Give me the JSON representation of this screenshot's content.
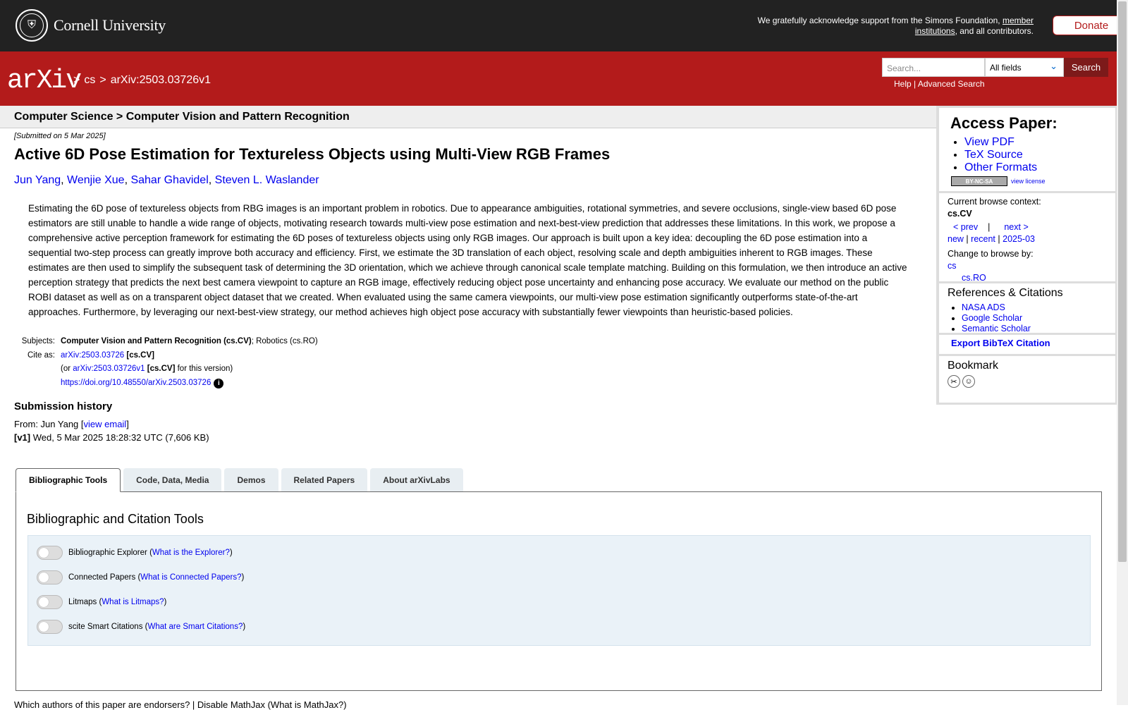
{
  "header": {
    "institution": "Cornell University",
    "support_pre": "We gratefully acknowledge support from the Simons Foundation,",
    "support_link": "member institutions",
    "support_post": ", and all contributors.",
    "donate": "Donate"
  },
  "nav": {
    "logo": "arXiv",
    "crumb_sep1": ">",
    "crumb_cs": "cs",
    "crumb_sep2": ">",
    "crumb_id": "arXiv:2503.03726v1",
    "search_placeholder": "Search...",
    "search_field": "All fields",
    "search_button": "Search",
    "help": "Help",
    "sep": "|",
    "advanced": "Advanced Search"
  },
  "paper": {
    "subject_header": "Computer Science > Computer Vision and Pattern Recognition",
    "submitted": "[Submitted on 5 Mar 2025]",
    "title": "Active 6D Pose Estimation for Textureless Objects using Multi-View RGB Frames",
    "authors": [
      "Jun Yang",
      "Wenjie Xue",
      "Sahar Ghavidel",
      "Steven L. Waslander"
    ],
    "abstract": "Estimating the 6D pose of textureless objects from RBG images is an important problem in robotics. Due to appearance ambiguities, rotational symmetries, and severe occlusions, single-view based 6D pose estimators are still unable to handle a wide range of objects, motivating research towards multi-view pose estimation and next-best-view prediction that addresses these limitations. In this work, we propose a comprehensive active perception framework for estimating the 6D poses of textureless objects using only RGB images. Our approach is built upon a key idea: decoupling the 6D pose estimation into a sequential two-step process can greatly improve both accuracy and efficiency. First, we estimate the 3D translation of each object, resolving scale and depth ambiguities inherent to RGB images. These estimates are then used to simplify the subsequent task of determining the 3D orientation, which we achieve through canonical scale template matching. Building on this formulation, we then introduce an active perception strategy that predicts the next best camera viewpoint to capture an RGB image, effectively reducing object pose uncertainty and enhancing pose accuracy. We evaluate our method on the public ROBI dataset as well as on a transparent object dataset that we created. When evaluated using the same camera viewpoints, our multi-view pose estimation significantly outperforms state-of-the-art approaches. Furthermore, by leveraging our next-best-view strategy, our method achieves high object pose accuracy with substantially fewer viewpoints than heuristic-based policies.",
    "subjects_label": "Subjects:",
    "subjects_primary": "Computer Vision and Pattern Recognition (cs.CV)",
    "subjects_rest": "; Robotics (cs.RO)",
    "cite_label": "Cite as:",
    "cite_id": "arXiv:2503.03726",
    "cite_cat": "[cs.CV]",
    "cite_or": "(or",
    "cite_version_id": "arXiv:2503.03726v1",
    "cite_version_cat": "[cs.CV]",
    "cite_version_post": "for this version)",
    "doi": "https://doi.org/10.48550/arXiv.2503.03726",
    "history_heading": "Submission history",
    "from_pre": "From: Jun Yang [",
    "view_email": "view email",
    "from_post": "]",
    "v1_label": "[v1]",
    "v1_text": "Wed, 5 Mar 2025 18:28:32 UTC (7,606 KB)"
  },
  "tabs": [
    "Bibliographic Tools",
    "Code, Data, Media",
    "Demos",
    "Related Papers",
    "About arXivLabs"
  ],
  "tools": {
    "heading": "Bibliographic and Citation Tools",
    "items": [
      {
        "label": "Bibliographic Explorer",
        "link": "What is the Explorer?"
      },
      {
        "label": "Connected Papers",
        "link": "What is Connected Papers?"
      },
      {
        "label": "Litmaps",
        "link": "What is Litmaps?"
      },
      {
        "label": "scite Smart Citations",
        "link": "What are Smart Citations?"
      }
    ]
  },
  "sidebar": {
    "access_heading": "Access Paper:",
    "view_pdf": "View PDF",
    "tex_source": "TeX Source",
    "other_formats": "Other Formats",
    "license_badge": "BY-NC-SA",
    "view_license": "view license",
    "browse_context": "Current browse context:",
    "context": "cs.CV",
    "prev": "< prev",
    "pipe": "|",
    "next": "next >",
    "new": "new",
    "recent": "recent",
    "month": "2025-03",
    "change_browse": "Change to browse by:",
    "browse_cs": "cs",
    "browse_ro": "cs.RO",
    "refs_heading": "References & Citations",
    "refs": [
      "NASA ADS",
      "Google Scholar",
      "Semantic Scholar"
    ],
    "export": "Export BibTeX Citation",
    "bookmark": "Bookmark"
  },
  "footer": {
    "link": "Which authors of this paper are endorsers? | Disable MathJax (What is MathJax?)"
  }
}
